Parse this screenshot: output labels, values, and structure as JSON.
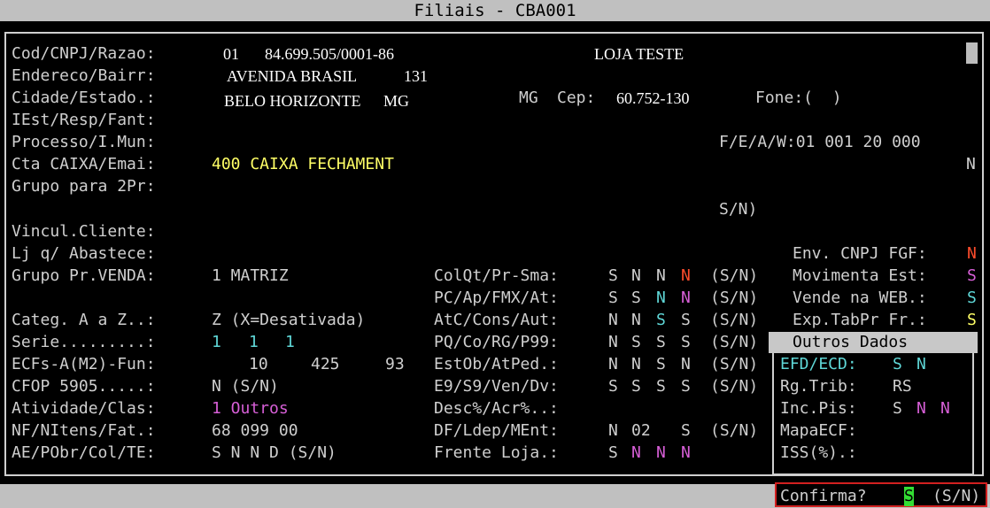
{
  "window": {
    "title": "Filiais - CBA001"
  },
  "labels": {
    "cod": "Cod/CNPJ/Razao:",
    "endereco": "Endereco/Bairr:",
    "cidade": "Cidade/Estado.:",
    "iest": "IEst/Resp/Fant:",
    "processo": "Processo/I.Mun:",
    "cta": "Cta CAIXA/Emai:",
    "grupo2": "Grupo para 2Pr:",
    "vincul": "Vincul.Cliente:",
    "ljq": "Lj q/ Abastece:",
    "grupovenda": "Grupo Pr.VENDA:",
    "categ": "Categ. A a Z..:",
    "serie": "Serie.........:",
    "ecfs": "ECFs-A(M2)-Fun:",
    "cfop": "CFOP 5905.....:",
    "atividade": "Atividade/Clas:",
    "nf": "NF/NItens/Fat.:",
    "ae": "AE/PObr/Col/TE:"
  },
  "values": {
    "cod": "01",
    "cnpj": "84.699.505/0001-86",
    "razao": "LOJA TESTE",
    "endereco": "AVENIDA BRASIL",
    "numero": "131",
    "cidade": "BELO HORIZONTE",
    "estado": "MG",
    "uf2": "MG",
    "cep_label": "Cep:",
    "cep": "60.752-130",
    "fone": "Fone:(  )",
    "fea": "F/E/A/W:01 001 20 000",
    "email_flag": "N",
    "cta": "400 CAIXA FECHAMENT",
    "sn_center": "S/N)",
    "grupovenda": "1 MATRIZ",
    "categ": "Z (X=Desativada)",
    "serie": [
      "1",
      "1",
      "1"
    ],
    "ecfs": [
      "10",
      "425",
      "93"
    ],
    "cfop": "N (S/N)",
    "atividade": "1 Outros",
    "nf": "68 099 00",
    "ae": "S N N D (S/N)"
  },
  "mid": [
    {
      "label": "ColQt/Pr-Sma:",
      "vals": [
        "S",
        "N",
        "N",
        "N"
      ],
      "sn": "(S/N)"
    },
    {
      "label": "PC/Ap/FMX/At:",
      "vals": [
        "S",
        "S",
        "N",
        "N"
      ],
      "sn": "(S/N)"
    },
    {
      "label": "AtC/Cons/Aut:",
      "vals": [
        "N",
        "N",
        "S",
        "S"
      ],
      "sn": "(S/N)"
    },
    {
      "label": "PQ/Co/RG/P99:",
      "vals": [
        "N",
        "S",
        "S",
        "S"
      ],
      "sn": "(S/N)"
    },
    {
      "label": "EstOb/AtPed.:",
      "vals": [
        "N",
        "N",
        "S",
        "N"
      ],
      "sn": "(S/N)"
    },
    {
      "label": "E9/S9/Ven/Dv:",
      "vals": [
        "S",
        "S",
        "S",
        "S"
      ],
      "sn": "(S/N)"
    },
    {
      "label": "Desc%/Acr%..:",
      "vals": [],
      "sn": ""
    },
    {
      "label": "DF/Ldep/MEnt:",
      "vals": [
        "N",
        "02",
        "",
        "S"
      ],
      "sn": "(S/N)"
    },
    {
      "label": "Frente Loja.:",
      "vals": [
        "S",
        "N",
        "N",
        "N"
      ],
      "sn": ""
    }
  ],
  "right": [
    {
      "label": "Env. CNPJ FGF:",
      "val": "N"
    },
    {
      "label": "Movimenta Est:",
      "val": "S"
    },
    {
      "label": "Vende na WEB.:",
      "val": "S"
    },
    {
      "label": "Exp.TabPr Fr.:",
      "val": "S"
    }
  ],
  "panel": {
    "title": "Outros Dados",
    "efd_label": "EFD/ECD:",
    "efd": [
      "S",
      "N"
    ],
    "rg_label": "Rg.Trib:",
    "rg": "RS",
    "inc_label": "Inc.Pis:",
    "inc": [
      "S",
      "N",
      "N"
    ],
    "mapa_label": "MapaECF:",
    "iss_label": "ISS(%).:"
  },
  "confirm": {
    "label": "Confirma?",
    "value": "S",
    "options": "(S/N)"
  },
  "colors": {
    "cyan": "#5fd7d7",
    "magenta": "#d75fd7",
    "yellow": "#ffff66",
    "red": "#ff4c2c",
    "highlight": "#33dd33"
  }
}
